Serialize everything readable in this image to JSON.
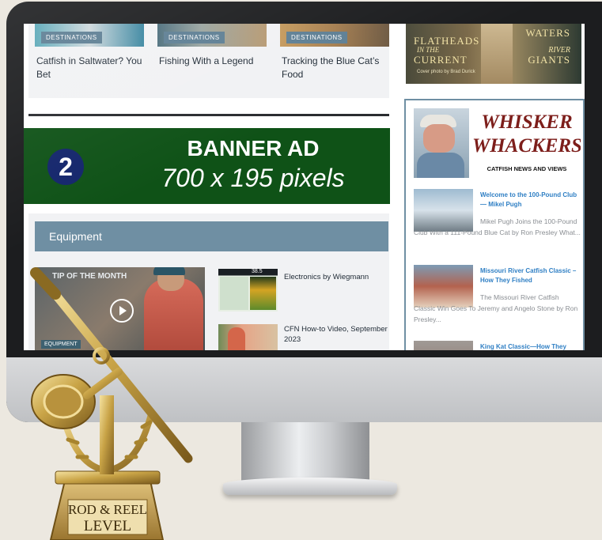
{
  "cards": [
    {
      "tag": "DESTINATIONS",
      "title": "Catfish in Saltwater? You Bet"
    },
    {
      "tag": "DESTINATIONS",
      "title": "Fishing With a Legend"
    },
    {
      "tag": "DESTINATIONS",
      "title": "Tracking the Blue Cat’s Food"
    }
  ],
  "banner": {
    "number": "2",
    "line1": "BANNER AD",
    "line2": "700 x 195 pixels"
  },
  "equipment": {
    "heading": "Equipment",
    "video": {
      "overlay": "TIP OF THE MONTH",
      "tag": "EQUIPMENT"
    },
    "sonar_readout": "38.5",
    "links": [
      "Electronics by Wiegmann",
      "CFN How-to Video, September 2023"
    ]
  },
  "promo": {
    "left_line1": "FLATHEADS",
    "left_line2": "IN THE",
    "left_line3": "CURRENT",
    "right_line1": "WATERS",
    "right_line2": "RIVER",
    "right_line3": "GIANTS",
    "small": "Cover photo by Brad Durick"
  },
  "whisker": {
    "line1": "WHISKER",
    "line2": "WHACKERS",
    "line3": "CATFISH NEWS AND VIEWS"
  },
  "news": [
    {
      "title": "Welcome to the 100-Pound Club — Mikel Pugh",
      "excerpt": "Mikel Pugh Joins the 100-Pound Club With a 111-Pound Blue Cat by Ron Presley What..."
    },
    {
      "title": "Missouri River Catfish Classic – How They Fished",
      "excerpt": "The Missouri River Catfish Classic Win Goes To Jeremy and Angelo Stone by Ron Presley..."
    },
    {
      "title": "King Kat Classic—How They Fished",
      "excerpt": ""
    }
  ],
  "award": {
    "line1": "ROD & REEL",
    "line2": "LEVEL"
  },
  "colors": {
    "banner_bg": "#0f5217",
    "badge_bg": "#13256b",
    "section_head": "#6f8fa3",
    "link": "#2f7fc4",
    "award_gold": "#c9a447"
  }
}
